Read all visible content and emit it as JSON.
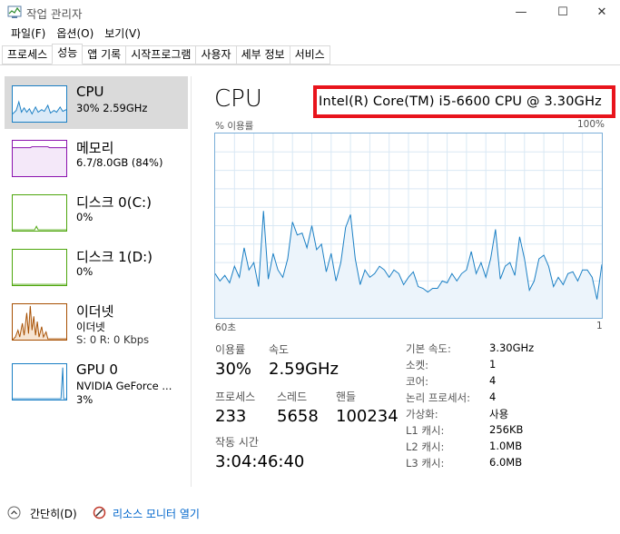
{
  "window": {
    "title": "작업 관리자",
    "minimize_glyph": "—",
    "maximize_glyph": "☐",
    "close_glyph": "✕"
  },
  "menu": [
    "파일(F)",
    "옵션(O)",
    "보기(V)"
  ],
  "tabs": [
    {
      "label": "프로세스",
      "active": false
    },
    {
      "label": "성능",
      "active": true
    },
    {
      "label": "앱 기록",
      "active": false
    },
    {
      "label": "시작프로그램",
      "active": false
    },
    {
      "label": "사용자",
      "active": false
    },
    {
      "label": "세부 정보",
      "active": false
    },
    {
      "label": "서비스",
      "active": false
    }
  ],
  "sidebar": {
    "items": [
      {
        "title": "CPU",
        "sub1": "30% 2.59GHz",
        "sub2": "",
        "color": "#1a7fc4",
        "icon": "cpu-sparkline"
      },
      {
        "title": "메모리",
        "sub1": "6.7/8.0GB (84%)",
        "sub2": "",
        "color": "#8b12ae",
        "icon": "memory-sparkline"
      },
      {
        "title": "디스크 0(C:)",
        "sub1": "0%",
        "sub2": "",
        "color": "#4da60c",
        "icon": "disk-sparkline"
      },
      {
        "title": "디스크 1(D:)",
        "sub1": "0%",
        "sub2": "",
        "color": "#4da60c",
        "icon": "disk-sparkline"
      },
      {
        "title": "이더넷",
        "sub1": "이더넷",
        "sub2": "S: 0 R: 0 Kbps",
        "color": "#a74f01",
        "icon": "ethernet-sparkline"
      },
      {
        "title": "GPU 0",
        "sub1": "NVIDIA GeForce ...",
        "sub2": "3%",
        "color": "#1a7fc4",
        "icon": "gpu-sparkline"
      }
    ]
  },
  "main": {
    "title": "CPU",
    "model": "Intel(R) Core(TM) i5-6600 CPU @ 3.30GHz",
    "highlight_color": "#e8141c",
    "graph": {
      "top_left_label": "% 이용률",
      "top_right_label": "100%",
      "bottom_left_label": "60초",
      "bottom_right_label": "1",
      "line_color": "#1a7fc4",
      "fill_color": "#ecf4fb",
      "grid_color": "#d9e8f4"
    },
    "stats": {
      "utilization_label": "이용률",
      "utilization": "30%",
      "speed_label": "속도",
      "speed": "2.59GHz",
      "processes_label": "프로세스",
      "processes": "233",
      "threads_label": "스레드",
      "threads": "5658",
      "handles_label": "핸들",
      "handles": "100234",
      "uptime_label": "작동 시간",
      "uptime": "3:04:46:40"
    },
    "specs": [
      {
        "label": "기본 속도:",
        "value": "3.30GHz"
      },
      {
        "label": "소켓:",
        "value": "1"
      },
      {
        "label": "코어:",
        "value": "4"
      },
      {
        "label": "논리 프로세서:",
        "value": "4"
      },
      {
        "label": "가상화:",
        "value": "사용"
      },
      {
        "label": "L1 캐시:",
        "value": "256KB"
      },
      {
        "label": "L2 캐시:",
        "value": "1.0MB"
      },
      {
        "label": "L3 캐시:",
        "value": "6.0MB"
      }
    ]
  },
  "footer": {
    "collapse_label": "간단히(D)",
    "resmon_label": "리소스 모니터 열기",
    "link_color": "#0066cc"
  }
}
